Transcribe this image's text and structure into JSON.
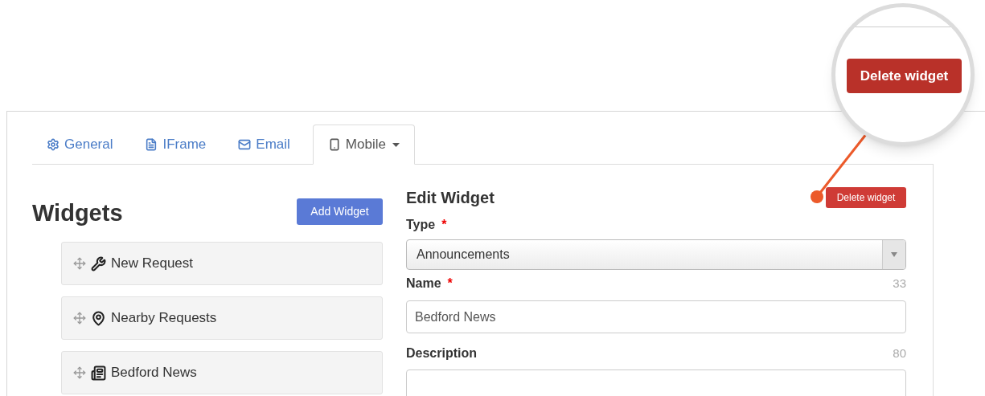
{
  "tabs": [
    {
      "label": "General",
      "selected": false,
      "dropdown": false
    },
    {
      "label": "IFrame",
      "selected": false,
      "dropdown": false
    },
    {
      "label": "Email",
      "selected": false,
      "dropdown": false
    },
    {
      "label": "Mobile",
      "selected": true,
      "dropdown": true
    }
  ],
  "widgets_panel": {
    "title": "Widgets",
    "add_button": "Add Widget",
    "items": [
      {
        "label": "New Request"
      },
      {
        "label": "Nearby Requests"
      },
      {
        "label": "Bedford News"
      }
    ]
  },
  "edit_panel": {
    "title": "Edit Widget",
    "delete_button": "Delete widget",
    "fields": [
      {
        "kind": "select",
        "label": "Type",
        "required_mark": "*",
        "value": "Announcements"
      },
      {
        "kind": "text",
        "label": "Name",
        "required_mark": "*",
        "counter": "33",
        "value": "Bedford News"
      },
      {
        "kind": "textarea",
        "label": "Description",
        "counter": "80"
      }
    ]
  },
  "magnifier": {
    "button": "Delete widget"
  }
}
